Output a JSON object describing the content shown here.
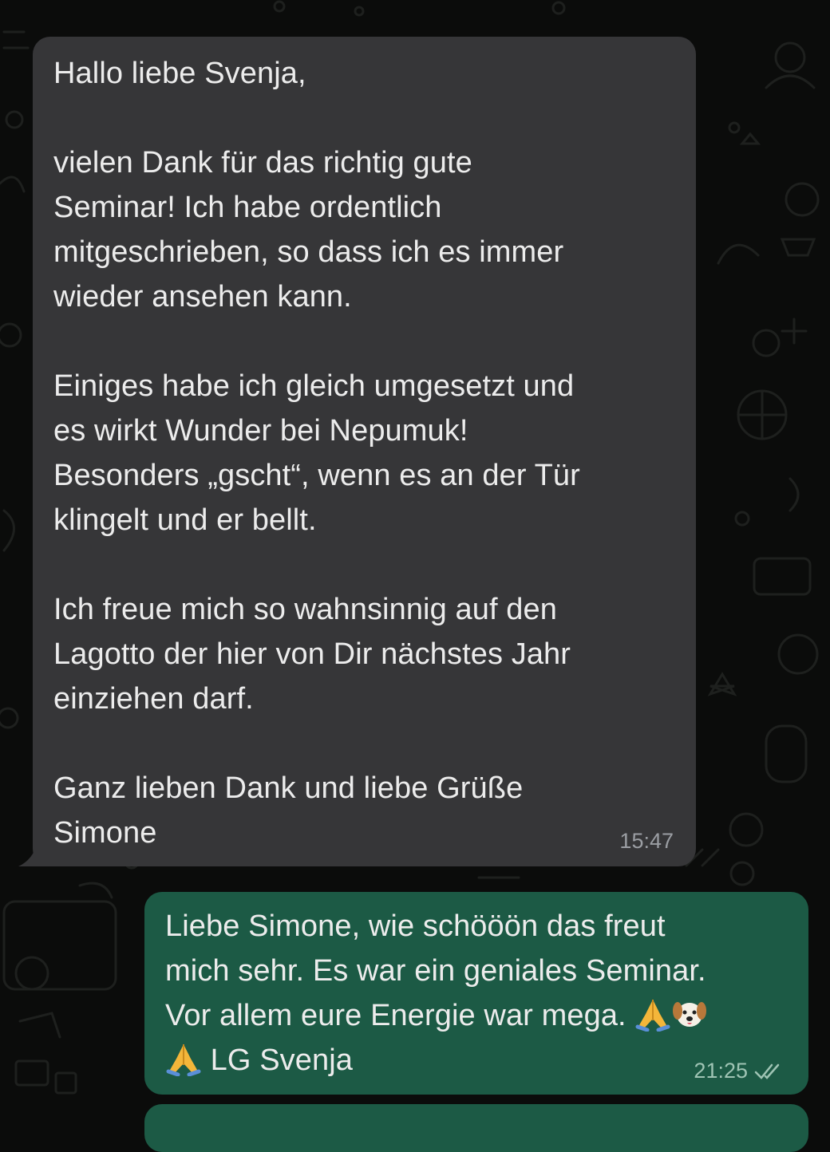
{
  "incoming_message": {
    "paragraphs": [
      "Hallo liebe Svenja,",
      "vielen Dank für das richtig gute\nSeminar! Ich habe ordentlich\nmitgeschrieben, so dass ich es immer\nwieder ansehen kann.",
      "Einiges habe ich gleich umgesetzt und\nes wirkt Wunder bei Nepumuk!\nBesonders „gscht“, wenn es an der Tür\nklingelt und er bellt.",
      "Ich freue mich so wahnsinnig auf den\nLagotto der hier von Dir nächstes Jahr\neinziehen darf.",
      "Ganz lieben Dank und liebe Grüße\nSimone"
    ],
    "time": "15:47",
    "bubble_color": "#363638"
  },
  "outgoing_message": {
    "lines": [
      "Liebe Simone, wie schööön das freut",
      "mich sehr. Es war ein geniales Seminar.",
      "Vor allem eure Energie war mega."
    ],
    "last_line": "LG Svenja",
    "emojis": [
      "folded-hands-emoji",
      "dog-face-emoji",
      "folded-hands-emoji"
    ],
    "time": "21:25",
    "status": "read-double-check-icon",
    "bubble_color": "#1c5a45"
  },
  "background": {
    "color": "#0b0c0b",
    "pattern": "chat-wallpaper-doodles"
  }
}
